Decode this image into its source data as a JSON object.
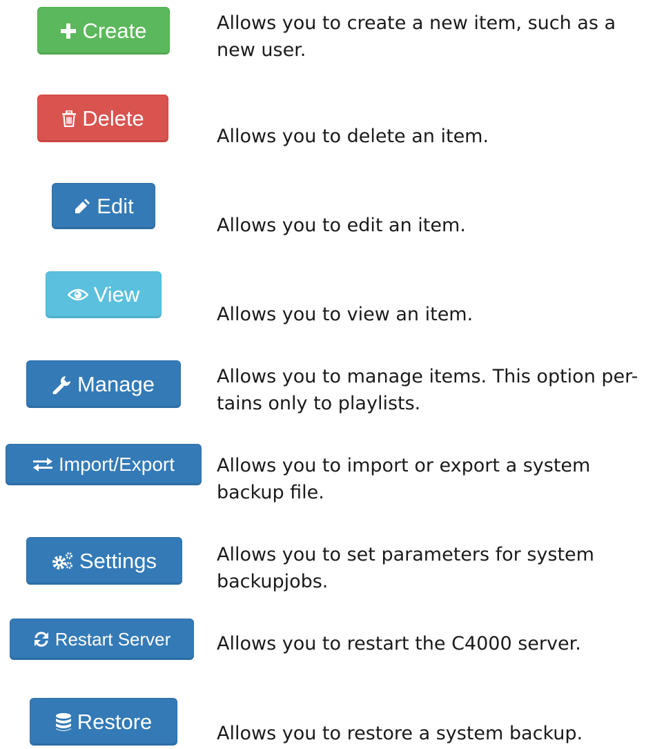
{
  "colors": {
    "create": "#5cb85c",
    "delete": "#d9534f",
    "primary": "#337ab7",
    "view": "#5bc0de"
  },
  "rows": [
    {
      "button": {
        "label": "Create",
        "icon": "plus-icon"
      },
      "description": "Allows you to create a new item, such as a new user."
    },
    {
      "button": {
        "label": "Delete",
        "icon": "trash-icon"
      },
      "description": "Allows you to delete an item."
    },
    {
      "button": {
        "label": "Edit",
        "icon": "pencil-icon"
      },
      "description": "Allows you to edit an item."
    },
    {
      "button": {
        "label": "View",
        "icon": "eye-icon"
      },
      "description": "Allows you to view an item."
    },
    {
      "button": {
        "label": "Manage",
        "icon": "wrench-icon"
      },
      "description": "Allows you to manage items. This option per-tains only to playlists."
    },
    {
      "button": {
        "label": "Import/Export",
        "icon": "swap-arrows-icon"
      },
      "description": "Allows you to import or export a system backup file."
    },
    {
      "button": {
        "label": "Settings",
        "icon": "gears-icon"
      },
      "description": "Allows you to set parameters for system backupjobs."
    },
    {
      "button": {
        "label": "Restart Server",
        "icon": "refresh-icon"
      },
      "description": "Allows you to restart the C4000 server."
    },
    {
      "button": {
        "label": "Restore",
        "icon": "database-icon"
      },
      "description": "Allows you to restore a system backup."
    }
  ]
}
